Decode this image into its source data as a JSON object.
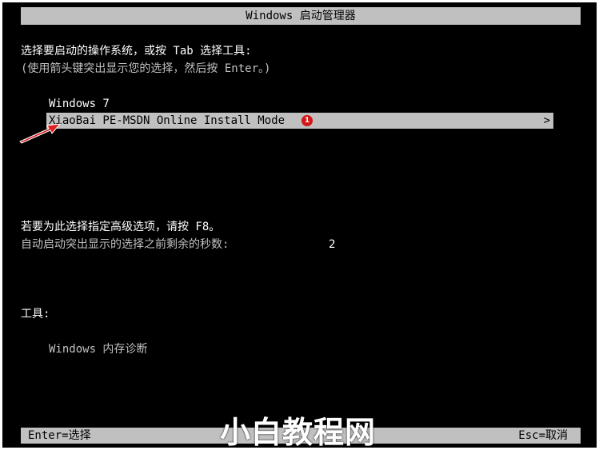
{
  "title": "Windows 启动管理器",
  "prompt": {
    "line1": "选择要启动的操作系统，或按 Tab 选择工具:",
    "line2": "(使用箭头键突出显示您的选择，然后按 Enter。)"
  },
  "os_list": [
    {
      "label": "Windows 7",
      "selected": false
    },
    {
      "label": "XiaoBai PE-MSDN Online Install Mode",
      "selected": true,
      "arrow": ">",
      "badge": "1"
    }
  ],
  "advanced": {
    "line1": "若要为此选择指定高级选项，请按 F8。",
    "line2": "自动启动突出显示的选择之前剩余的秒数:",
    "seconds": "2"
  },
  "tools": {
    "heading": "工具:",
    "items": [
      {
        "label": "Windows 内存诊断"
      }
    ]
  },
  "footer": {
    "left": "Enter=选择",
    "right": "Esc=取消"
  },
  "watermark": "小白教程网",
  "colors": {
    "background": "#000000",
    "bar": "#c0c0c0",
    "text": "#c0c0c0",
    "badge": "#d41616",
    "pointer_arrow": "#e02020"
  }
}
